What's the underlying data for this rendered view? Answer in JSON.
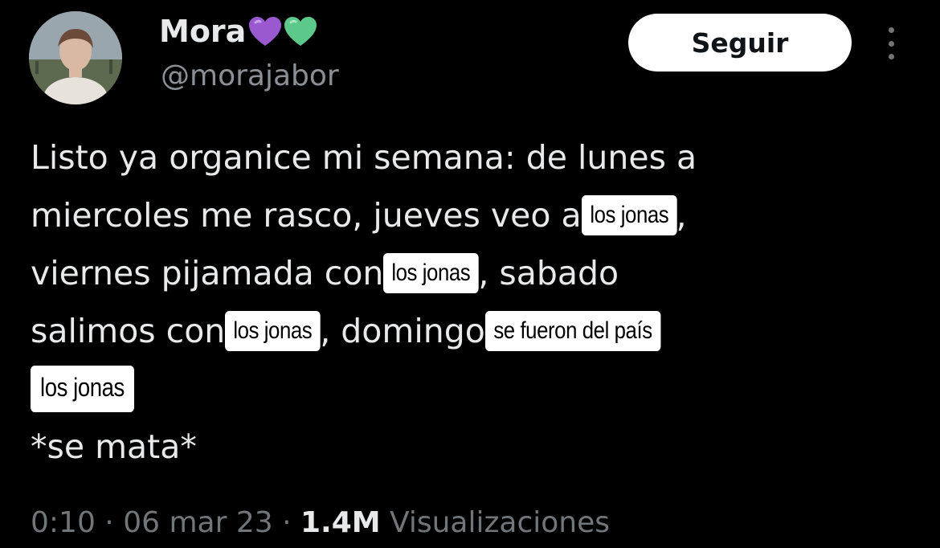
{
  "author": {
    "display_name": "Mora",
    "handle": "@morajabor",
    "hearts": [
      {
        "icon": "purple-heart-icon",
        "color": "#9b59d0"
      },
      {
        "icon": "green-heart-icon",
        "color": "#5cc98a"
      }
    ]
  },
  "follow_button": {
    "label": "Seguir"
  },
  "more_button": {
    "icon": "more-options-icon"
  },
  "tweet": {
    "line1": "Listo ya organice mi semana: de lunes a",
    "line2_pre": "miercoles me rasco, jueves veo a ",
    "tag1": "los jonas",
    "line2_post": ",",
    "line3_pre": "viernes pijamada con ",
    "tag2": "los jonas",
    "line3_post": ", sabado",
    "line4_pre": "salimos con ",
    "tag3": "los jonas",
    "line4_mid": ", domingo ",
    "tag4": "se fueron del país",
    "tag5": "los jonas",
    "line6": "*se mata*"
  },
  "meta": {
    "time": "0:10",
    "sep1": " · ",
    "date": "06 mar 23",
    "sep2": " · ",
    "views_count": "1.4M",
    "views_label": " Visualizaciones"
  },
  "colors": {
    "background": "#000000",
    "text_primary": "#e7e9ea",
    "text_secondary": "#71767b",
    "button_bg": "#ffffff"
  }
}
